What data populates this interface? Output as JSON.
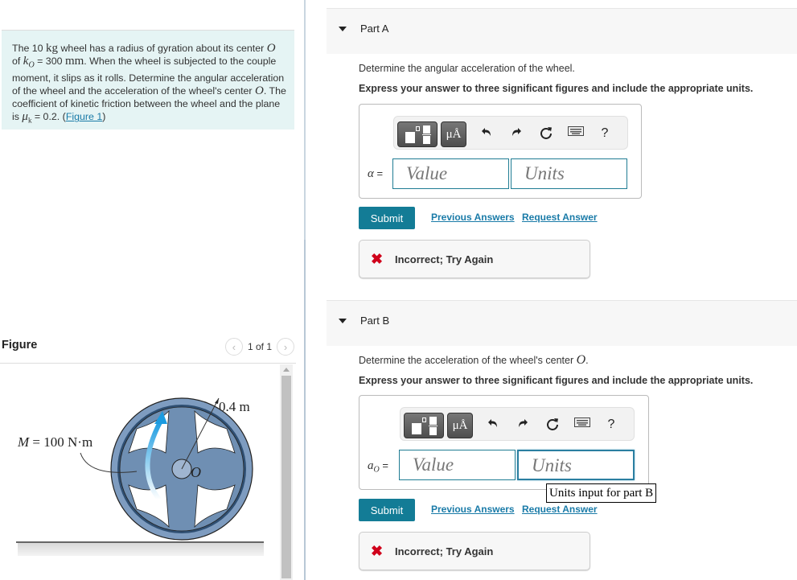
{
  "problem": {
    "t1": "The 10 ",
    "kg": "kg",
    "t2": " wheel has a radius of gyration about its center ",
    "O": "O",
    "t3": " of ",
    "kO": "k",
    "kO_sub": "O",
    "t4": " = 300 ",
    "mm": "mm",
    "t5": ". When the wheel is subjected to the couple moment, it slips as it rolls. Determine the angular acceleration of the wheel and the acceleration of the wheel's center ",
    "O2": "O",
    "t6": ". The coefficient of kinetic friction between the wheel and the plane is ",
    "mu": "μ",
    "mu_sub": "k",
    "t7": " = 0.2. ",
    "figure_link": "Figure 1",
    "paren_open": "(",
    "paren_close": ")"
  },
  "figure_panel": {
    "title": "Figure",
    "pager": "1 of 1",
    "prev_icon": "‹",
    "next_icon": "›",
    "labels": {
      "moment": "M = 100 N·m",
      "moment_M": "M",
      "moment_rest": " = 100 N·m",
      "radius": "0.4 m",
      "center": "O"
    }
  },
  "parts": [
    {
      "label": "Part A",
      "question": "Determine the angular acceleration of the wheel.",
      "instruction": "Express your answer to three significant figures and include the appropriate units.",
      "var": "α",
      "eq": " =",
      "value_placeholder": "Value",
      "units_placeholder": "Units",
      "submit": "Submit",
      "previous_answers": "Previous Answers",
      "request_answer": "Request Answer",
      "feedback": "Incorrect; Try Again"
    },
    {
      "label": "Part B",
      "question": "Determine the acceleration of the wheel's center ",
      "question_var": "O",
      "question_end": ".",
      "instruction": "Express your answer to three significant figures and include the appropriate units.",
      "var": "a",
      "var_sub": "O",
      "eq": " =",
      "value_placeholder": "Value",
      "units_placeholder": "Units",
      "submit": "Submit",
      "previous_answers": "Previous Answers",
      "request_answer": "Request Answer",
      "feedback": "Incorrect; Try Again",
      "tooltip": "Units input for part B"
    }
  ],
  "toolbar": {
    "units_btn": "μÅ",
    "help": "?",
    "icons": [
      "templates-icon",
      "units-icon",
      "undo-icon",
      "redo-icon",
      "reset-icon",
      "keyboard-icon",
      "help-icon"
    ]
  },
  "feedback_icon": "✖",
  "colors": {
    "accent": "#137c96",
    "link": "#1a7ba8",
    "error": "#d0021b",
    "problem_bg": "#e5f4f4",
    "wheel": "#6f8fb3"
  }
}
